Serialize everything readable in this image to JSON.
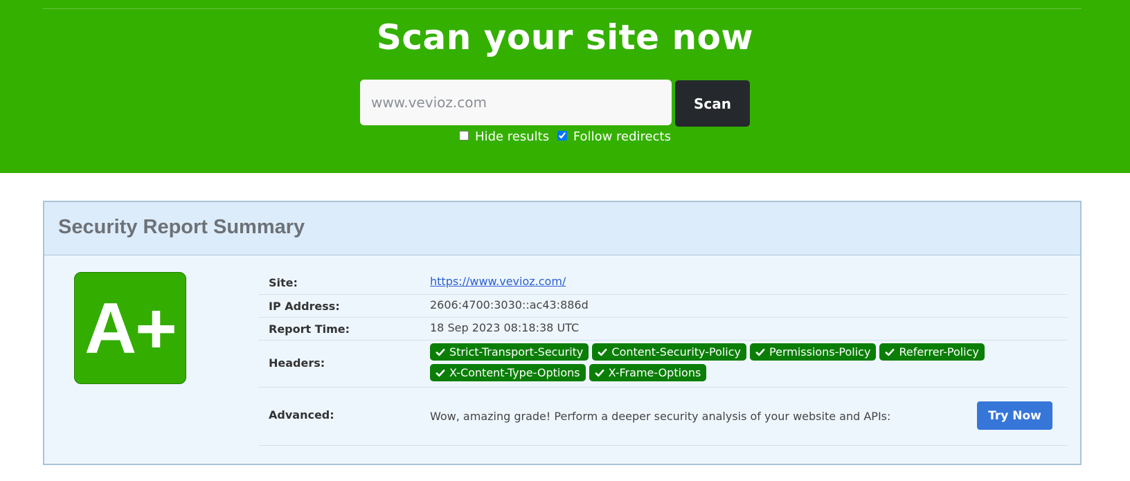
{
  "hero": {
    "title": "Scan your site now",
    "input_placeholder": "www.vevioz.com",
    "scan_label": "Scan",
    "hide_results_label": "Hide results",
    "hide_results_checked": false,
    "follow_redirects_label": "Follow redirects",
    "follow_redirects_checked": true
  },
  "report": {
    "title": "Security Report Summary",
    "grade": "A+",
    "rows": {
      "site": {
        "label": "Site:",
        "value": "https://www.vevioz.com/"
      },
      "ip": {
        "label": "IP Address:",
        "value": "2606:4700:3030::ac43:886d"
      },
      "time": {
        "label": "Report Time:",
        "value": "18 Sep 2023 08:18:38 UTC"
      },
      "headers": {
        "label": "Headers:",
        "badges": [
          "Strict-Transport-Security",
          "Content-Security-Policy",
          "Permissions-Policy",
          "Referrer-Policy",
          "X-Content-Type-Options",
          "X-Frame-Options"
        ]
      },
      "advanced": {
        "label": "Advanced:",
        "text": "Wow, amazing grade! Perform a deeper security analysis of your website and APIs:",
        "button_label": "Try Now"
      }
    }
  },
  "colors": {
    "hero_bg": "#34b000",
    "grade_bg": "#33ad00",
    "badge_bg": "#0b7e08",
    "scan_button_bg": "#25292d",
    "try_button_bg": "#3676d8",
    "link": "#2a5fd1"
  },
  "icons": {
    "badge": "check-icon"
  }
}
